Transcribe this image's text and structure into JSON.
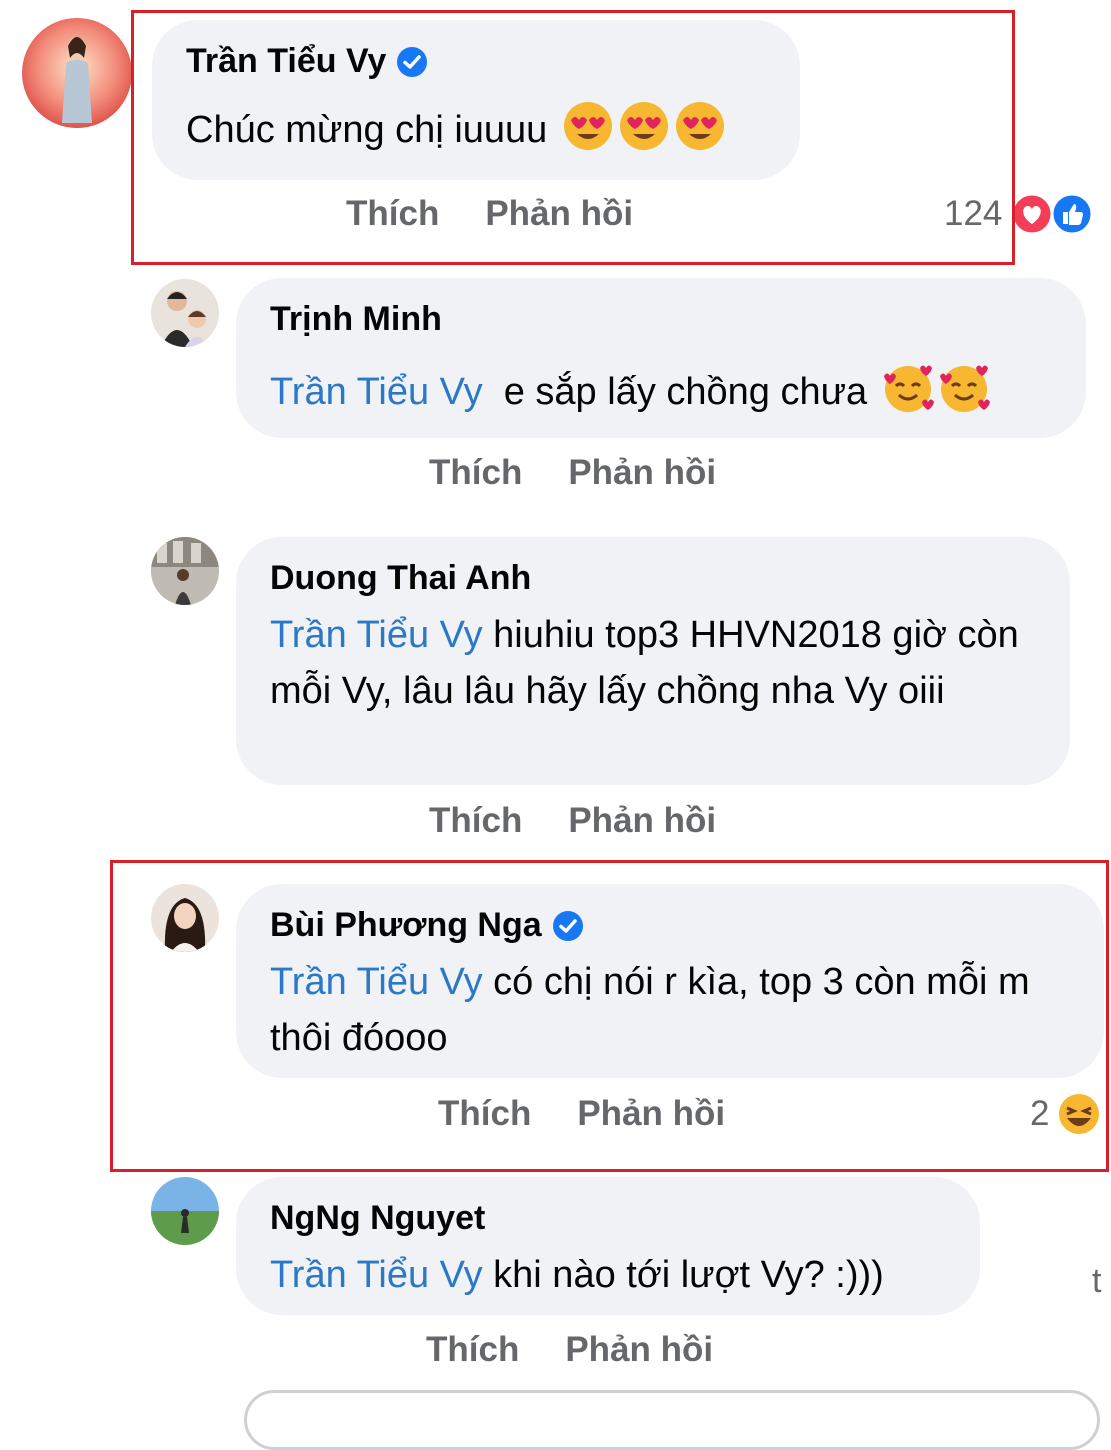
{
  "comments": [
    {
      "author": "Trần Tiểu Vy",
      "verified": true,
      "text": "Chúc mừng chị iuuuu",
      "emoji": "heart-eyes",
      "actions": {
        "like": "Thích",
        "reply": "Phản hồi"
      },
      "reaction_count": "124",
      "reaction_icons": [
        "love",
        "like"
      ]
    },
    {
      "author": "Trịnh Minh",
      "mention": "Trần Tiểu Vy",
      "text": "e sắp lấy chồng chưa",
      "emoji": "smiling-hearts",
      "actions": {
        "like": "Thích",
        "reply": "Phản hồi"
      }
    },
    {
      "author": "Duong Thai Anh",
      "mention": "Trần Tiểu Vy",
      "text": "hiuhiu top3 HHVN2018 giờ còn mỗi Vy, lâu lâu hãy lấy chồng nha Vy oiii",
      "actions": {
        "like": "Thích",
        "reply": "Phản hồi"
      }
    },
    {
      "author": "Bùi Phương Nga",
      "verified": true,
      "mention": "Trần Tiểu Vy",
      "text": "có chị nói r kìa, top 3 còn mỗi m thôi đóooo",
      "actions": {
        "like": "Thích",
        "reply": "Phản hồi"
      },
      "reaction_count": "2",
      "reaction_icons": [
        "haha"
      ]
    },
    {
      "author": "NgNg Nguyet",
      "mention": "Trần Tiểu Vy",
      "text": "khi nào tới lượt Vy? :)))",
      "actions": {
        "like": "Thích",
        "reply": "Phản hồi"
      }
    }
  ],
  "edge_text": "t",
  "colors": {
    "highlight": "#d7202a",
    "mention": "#2b78c7",
    "bubble": "#f0f2f5",
    "meta": "#65676b"
  }
}
